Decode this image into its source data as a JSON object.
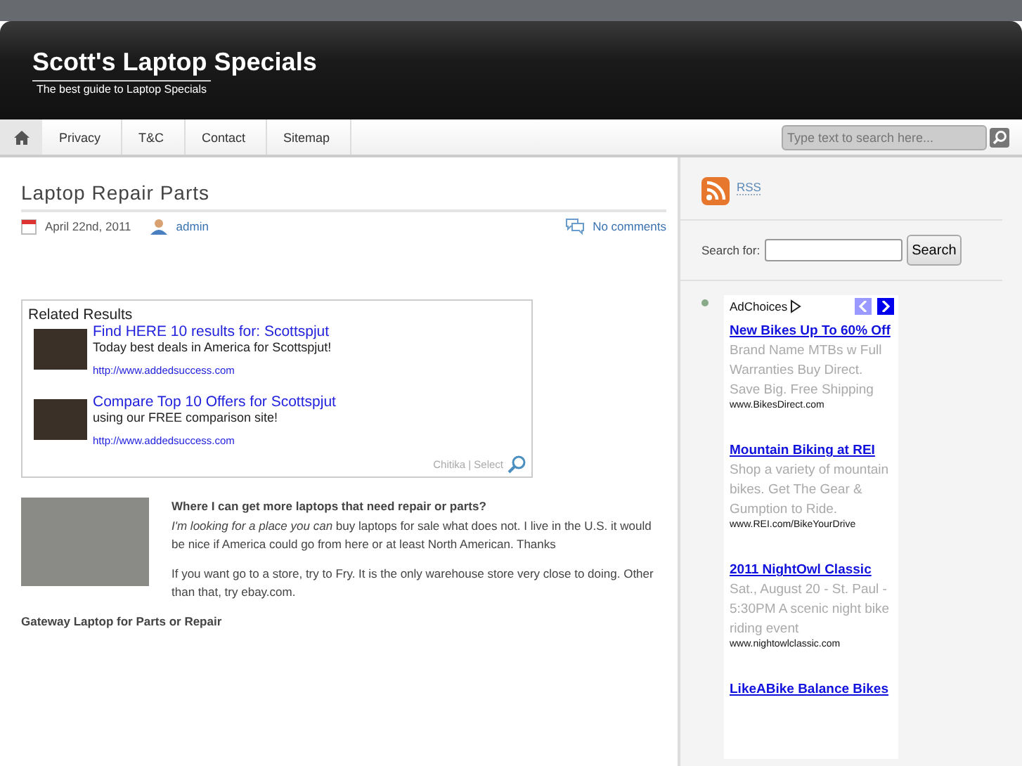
{
  "header": {
    "title": "Scott's Laptop Specials",
    "tagline": "The best guide to Laptop Specials"
  },
  "nav": {
    "items": [
      {
        "label": "Privacy"
      },
      {
        "label": "T&C"
      },
      {
        "label": "Contact"
      },
      {
        "label": "Sitemap"
      }
    ],
    "search": {
      "placeholder": "Type text to search here..."
    }
  },
  "post": {
    "title": "Laptop Repair Parts",
    "date": "April 22nd, 2011",
    "author": "admin",
    "comments": "No comments",
    "related": {
      "title": "Related Results",
      "items": [
        {
          "title": "Find HERE 10 results for: Scottspjut",
          "text": "Today best deals in America for Scottspjut!",
          "url": "http://www.addedsuccess.com"
        },
        {
          "title": "Compare Top 10 Offers for Scottspjut",
          "text": "using our FREE comparison site!",
          "url": "http://www.addedsuccess.com"
        }
      ],
      "footer": "Chitika | Select"
    },
    "question": "Where I can get more laptops that need repair or parts?",
    "paragraph": "*I'm looking for a place you can* buy laptops for sale what does not. I live in the U.S. it would be nice if America could go from here or at least North American. Thanks",
    "answer": "If you want go to a store, try to Fry. It is the only warehouse store very close to doing. Other than that, try ebay.com.",
    "subheading": "Gateway Laptop for Parts or Repair"
  },
  "sidebar": {
    "rss": "RSS",
    "search_label": "Search for:",
    "search_button": "Search",
    "ads": {
      "adchoices": "AdChoices",
      "items": [
        {
          "title": "New Bikes Up To 60% Off",
          "text": "Brand Name MTBs w Full Warranties Buy Direct. Save Big. Free Shipping",
          "url": "www.BikesDirect.com"
        },
        {
          "title": "Mountain Biking at REI",
          "text": "Shop a variety of mountain bikes. Get The Gear & Gumption to Ride.",
          "url": "www.REI.com/BikeYourDrive"
        },
        {
          "title": "2011 NightOwl Classic",
          "text": "Sat., August 20 - St. Paul - 5:30PM A scenic night bike riding event",
          "url": "www.nightowlclassic.com"
        },
        {
          "title": "LikeABike Balance Bikes"
        }
      ]
    }
  }
}
